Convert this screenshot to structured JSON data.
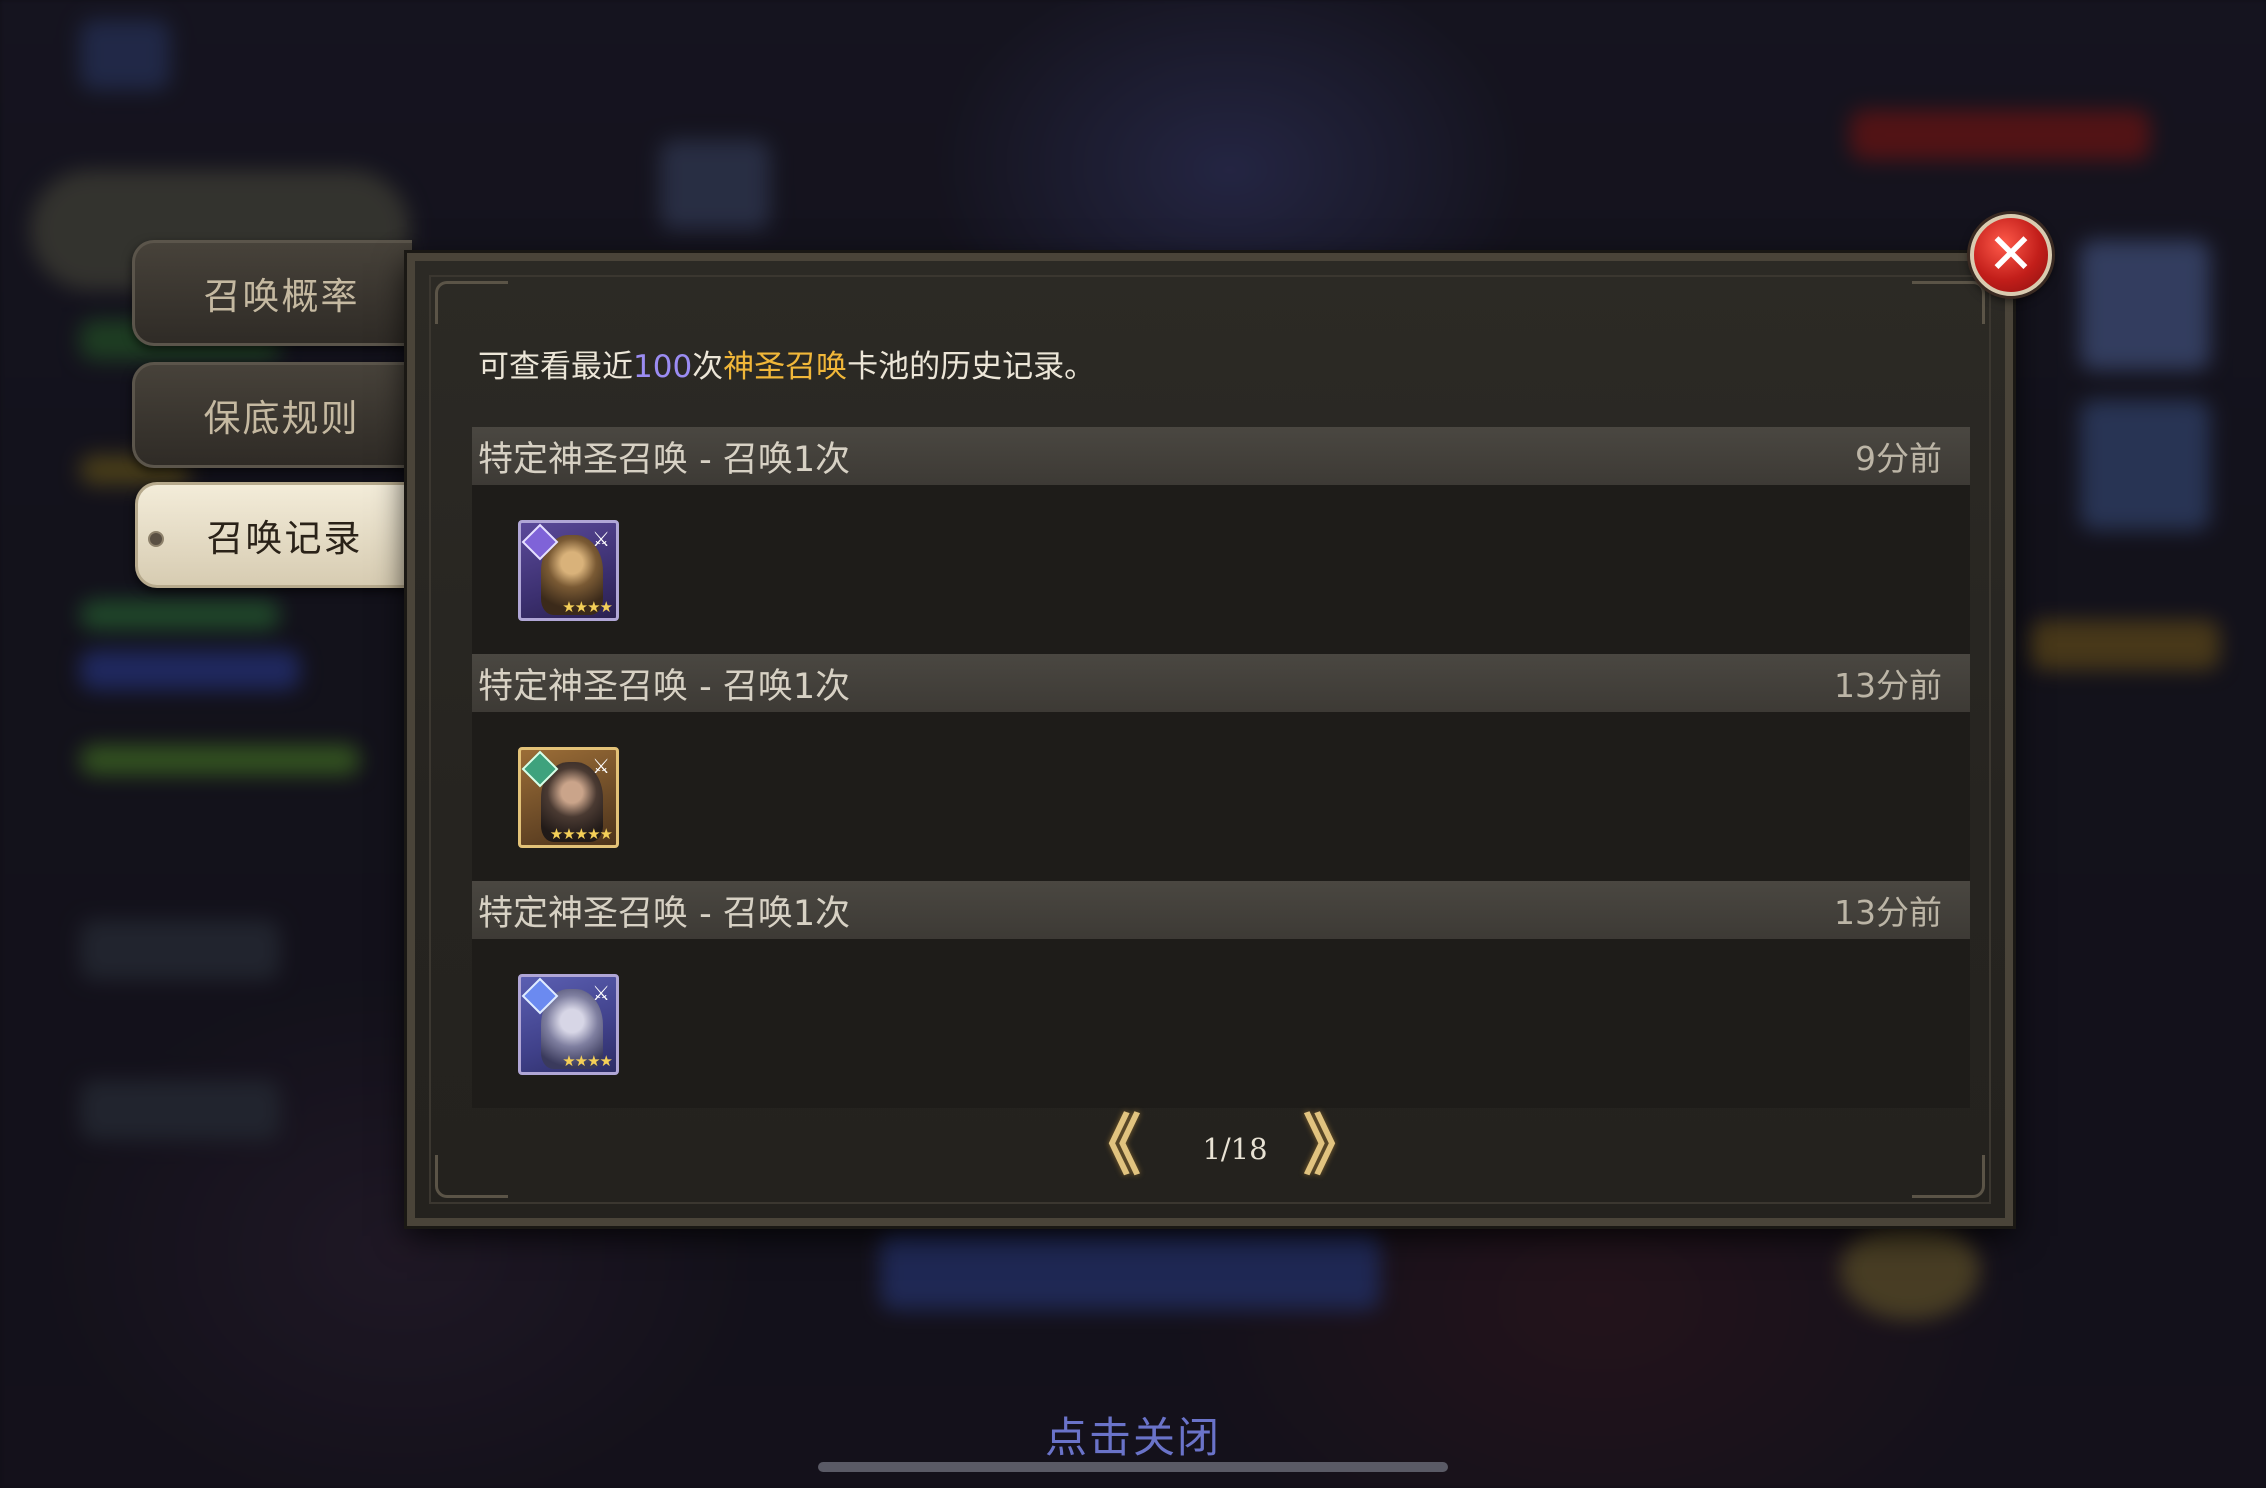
{
  "tabs": [
    {
      "label": "召唤概率",
      "active": false
    },
    {
      "label": "保底规则",
      "active": false
    },
    {
      "label": "召唤记录",
      "active": true
    }
  ],
  "info": {
    "prefix": "可查看最近",
    "count": "100",
    "mid": "次",
    "pool": "神圣召唤",
    "suffix": "卡池的历史记录。"
  },
  "records": [
    {
      "title": "特定神圣召唤 - 召唤1次",
      "time": "9分前",
      "hero": {
        "rarity": "purple",
        "stars": "★★★★"
      }
    },
    {
      "title": "特定神圣召唤 - 召唤1次",
      "time": "13分前",
      "hero": {
        "rarity": "gold",
        "stars": "★★★★★"
      }
    },
    {
      "title": "特定神圣召唤 - 召唤1次",
      "time": "13分前",
      "hero": {
        "rarity": "blue",
        "stars": "★★★★"
      }
    }
  ],
  "pager": {
    "page": "1/18",
    "prev": "《",
    "next": "》"
  },
  "close_icon": "✕",
  "footer": {
    "tap_to_close": "点击关闭"
  }
}
